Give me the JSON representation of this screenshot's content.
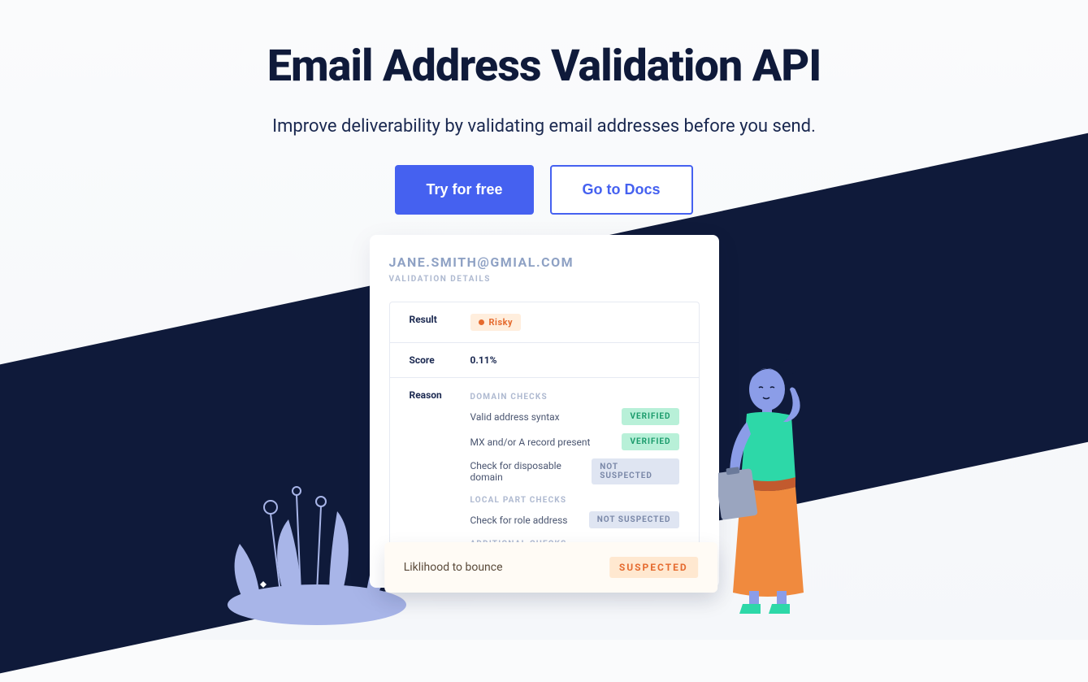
{
  "hero": {
    "title": "Email Address Validation API",
    "subtitle": "Improve deliverability by validating email addresses before you send.",
    "primary_cta": "Try for free",
    "secondary_cta": "Go to Docs"
  },
  "card": {
    "email": "JANE.SMITH@GMIAL.COM",
    "details_label": "VALIDATION DETAILS",
    "result_label": "Result",
    "result_value": "Risky",
    "score_label": "Score",
    "score_value": "0.11%",
    "reason_label": "Reason",
    "domain_checks_title": "DOMAIN CHECKS",
    "domain_checks": [
      {
        "text": "Valid address syntax",
        "status": "VERIFIED",
        "kind": "verified"
      },
      {
        "text": "MX and/or A record present",
        "status": "VERIFIED",
        "kind": "verified"
      },
      {
        "text": "Check for disposable domain",
        "status": "NOT SUSPECTED",
        "kind": "notsus"
      }
    ],
    "local_checks_title": "LOCAL PART CHECKS",
    "local_checks": [
      {
        "text": "Check for role address",
        "status": "NOT SUSPECTED",
        "kind": "notsus"
      }
    ],
    "additional_checks_title": "ADDITIONAL CHECKS"
  },
  "bounce": {
    "text": "Liklihood to bounce",
    "status": "SUSPECTED"
  }
}
